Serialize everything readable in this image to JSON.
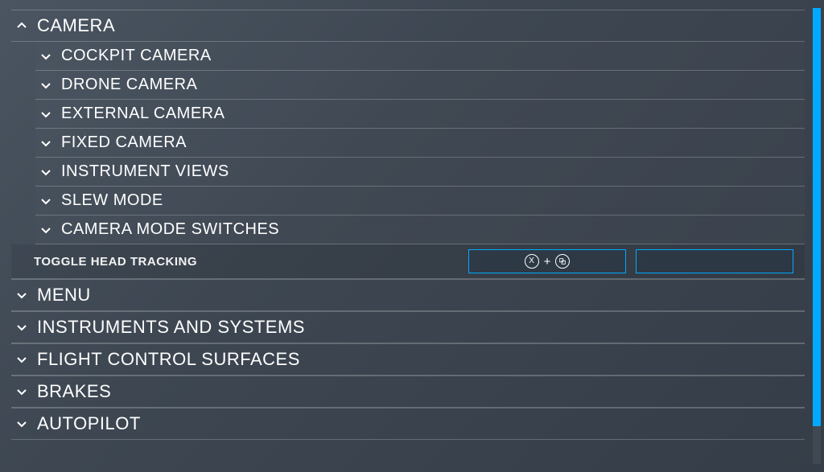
{
  "colors": {
    "accent": "#00aaff"
  },
  "sections": {
    "camera": {
      "label": "CAMERA",
      "expanded": true,
      "children": {
        "cockpit": {
          "label": "COCKPIT CAMERA"
        },
        "drone": {
          "label": "DRONE CAMERA"
        },
        "external": {
          "label": "EXTERNAL CAMERA"
        },
        "fixed": {
          "label": "FIXED CAMERA"
        },
        "instrument": {
          "label": "INSTRUMENT VIEWS"
        },
        "slew": {
          "label": "SLEW MODE"
        },
        "modeswitch": {
          "label": "CAMERA MODE SWITCHES"
        }
      },
      "bindings": {
        "toggle_head_tracking": {
          "label": "TOGGLE HEAD TRACKING",
          "slot1": {
            "button1": "X",
            "plus": "+",
            "button2": "view-icon"
          },
          "slot2": ""
        }
      }
    },
    "menu": {
      "label": "MENU"
    },
    "instruments": {
      "label": "INSTRUMENTS AND SYSTEMS"
    },
    "flightcontrol": {
      "label": "FLIGHT CONTROL SURFACES"
    },
    "brakes": {
      "label": "BRAKES"
    },
    "autopilot": {
      "label": "AUTOPILOT"
    }
  }
}
